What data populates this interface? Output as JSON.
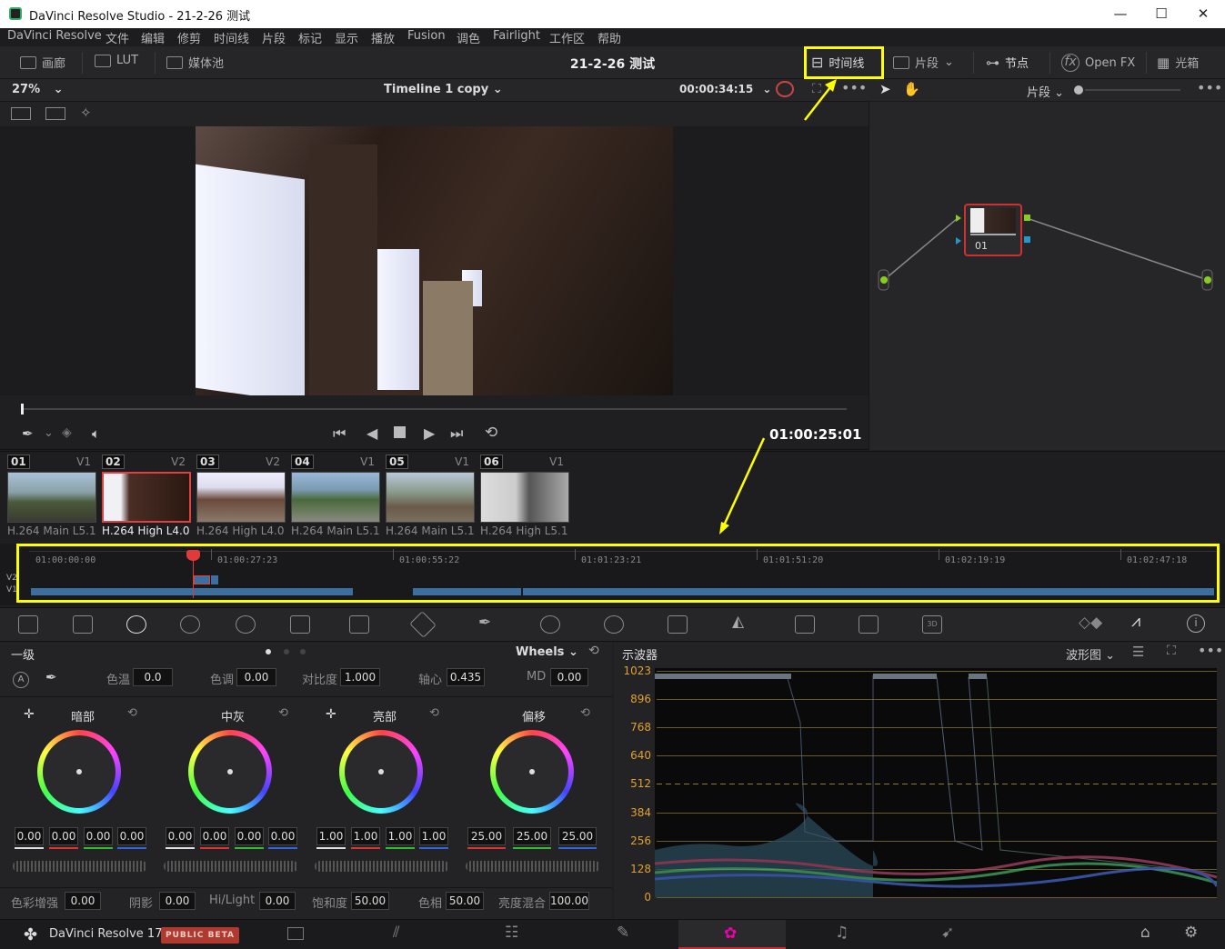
{
  "window": {
    "title": "DaVinci Resolve Studio - 21-2-26 测试",
    "min": "—",
    "max": "☐",
    "close": "✕"
  },
  "menu": [
    "DaVinci Resolve",
    "文件",
    "编辑",
    "修剪",
    "时间线",
    "片段",
    "标记",
    "显示",
    "播放",
    "Fusion",
    "调色",
    "Fairlight",
    "工作区",
    "帮助"
  ],
  "toolbar": {
    "gallery": "画廊",
    "lut": "LUT",
    "media_pool": "媒体池",
    "project_title": "21-2-26 测试",
    "timeline": "时间线",
    "clips": "片段",
    "nodes": "节点",
    "openfx": "Open FX",
    "lightbox": "光箱"
  },
  "viewer": {
    "zoom": "27%",
    "timeline_name": "Timeline 1 copy",
    "timecode": "00:00:34:15"
  },
  "nodes_header": {
    "mode": "片段"
  },
  "node": {
    "label": "01"
  },
  "callout_tc": "01:00:25:01",
  "clips": [
    {
      "num": "01",
      "track": "V1",
      "codec": "H.264 Main L5.1"
    },
    {
      "num": "02",
      "track": "V2",
      "codec": "H.264 High L4.0"
    },
    {
      "num": "03",
      "track": "V2",
      "codec": "H.264 High L4.0"
    },
    {
      "num": "04",
      "track": "V1",
      "codec": "H.264 Main L5.1"
    },
    {
      "num": "05",
      "track": "V1",
      "codec": "H.264 Main L5.1"
    },
    {
      "num": "06",
      "track": "V1",
      "codec": "H.264 High L5.1"
    }
  ],
  "mini_timeline": {
    "ticks": [
      "01:00:00:00",
      "01:00:27:23",
      "01:00:55:22",
      "01:01:23:21",
      "01:01:51:20",
      "01:02:19:19",
      "01:02:47:18"
    ],
    "tracks": [
      "V2",
      "V1"
    ]
  },
  "wheels": {
    "title": "一级",
    "mode": "Wheels",
    "top": {
      "temp_lbl": "色温",
      "temp": "0.0",
      "tint_lbl": "色调",
      "tint": "0.00",
      "contrast_lbl": "对比度",
      "contrast": "1.000",
      "pivot_lbl": "轴心",
      "pivot": "0.435",
      "md_lbl": "MD",
      "md": "0.00"
    },
    "w": [
      {
        "name": "暗部",
        "vals": [
          "0.00",
          "0.00",
          "0.00",
          "0.00"
        ]
      },
      {
        "name": "中灰",
        "vals": [
          "0.00",
          "0.00",
          "0.00",
          "0.00"
        ]
      },
      {
        "name": "亮部",
        "vals": [
          "1.00",
          "1.00",
          "1.00",
          "1.00"
        ]
      },
      {
        "name": "偏移",
        "vals": [
          "25.00",
          "25.00",
          "25.00"
        ]
      }
    ],
    "bottom": {
      "boost_lbl": "色彩增强",
      "boost": "0.00",
      "shadow_lbl": "阴影",
      "shadow": "0.00",
      "hilight_lbl": "Hi/Light",
      "hilight": "0.00",
      "sat_lbl": "饱和度",
      "sat": "50.00",
      "hue_lbl": "色相",
      "hue": "50.00",
      "lummix_lbl": "亮度混合",
      "lummix": "100.00"
    }
  },
  "scope": {
    "title": "示波器",
    "type": "波形图",
    "y_labels": [
      "1023",
      "896",
      "768",
      "640",
      "512",
      "384",
      "256",
      "128",
      "0"
    ]
  },
  "bottom": {
    "brand": "DaVinci Resolve 17",
    "beta": "PUBLIC BETA"
  },
  "colors": {
    "accent_yellow": "#ffff00",
    "playhead_red": "#e03a3a",
    "clip_blue": "#3a6fa0",
    "scope_orange": "#e0a030"
  }
}
